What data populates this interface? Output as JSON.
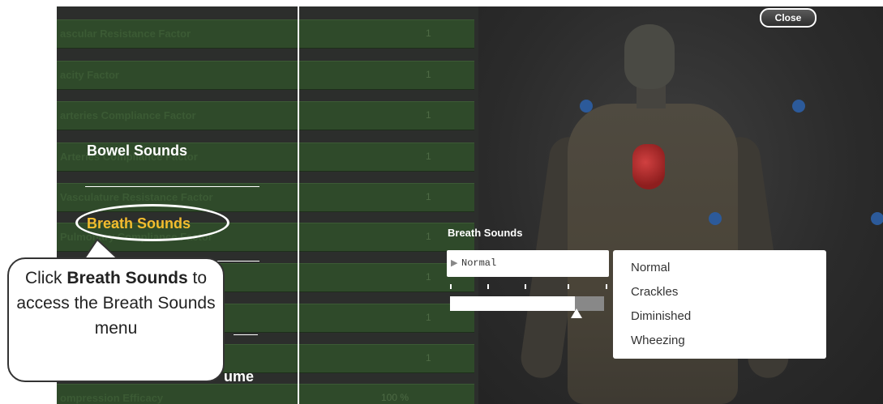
{
  "parameters": [
    {
      "label": "ascular Resistance Factor",
      "value": "1"
    },
    {
      "label": "acity Factor",
      "value": "1"
    },
    {
      "label": "arteries Compliance Factor",
      "value": "1"
    },
    {
      "label": "Arteries Compliance Factor",
      "value": "1"
    },
    {
      "label": "Vasculature Resistance Factor",
      "value": "1"
    },
    {
      "label": "Pulmonary Compliance Factor",
      "value": "1"
    },
    {
      "label": "",
      "value": "1"
    },
    {
      "label": "",
      "value": "1"
    },
    {
      "label": "",
      "value": "1"
    },
    {
      "label": "ompression Efficacy",
      "value": "100 %"
    }
  ],
  "menu": {
    "bowel_sounds": "Bowel Sounds",
    "breath_sounds": "Breath Sounds",
    "volume_partial": "ume"
  },
  "close_button": "Close",
  "breath_panel": {
    "title": "Breath Sounds",
    "selected": "Normal",
    "slider_fraction": 0.82
  },
  "dropdown_options": [
    "Normal",
    "Crackles",
    "Diminished",
    "Wheezing"
  ],
  "callout": {
    "prefix": "Click",
    "bold": "Breath Sounds",
    "suffix": "to access the Breath Sounds menu"
  },
  "colors": {
    "highlight": "#f3bc2e",
    "row_green": "#2f4a2a",
    "marker_blue": "#2c5a9a"
  }
}
